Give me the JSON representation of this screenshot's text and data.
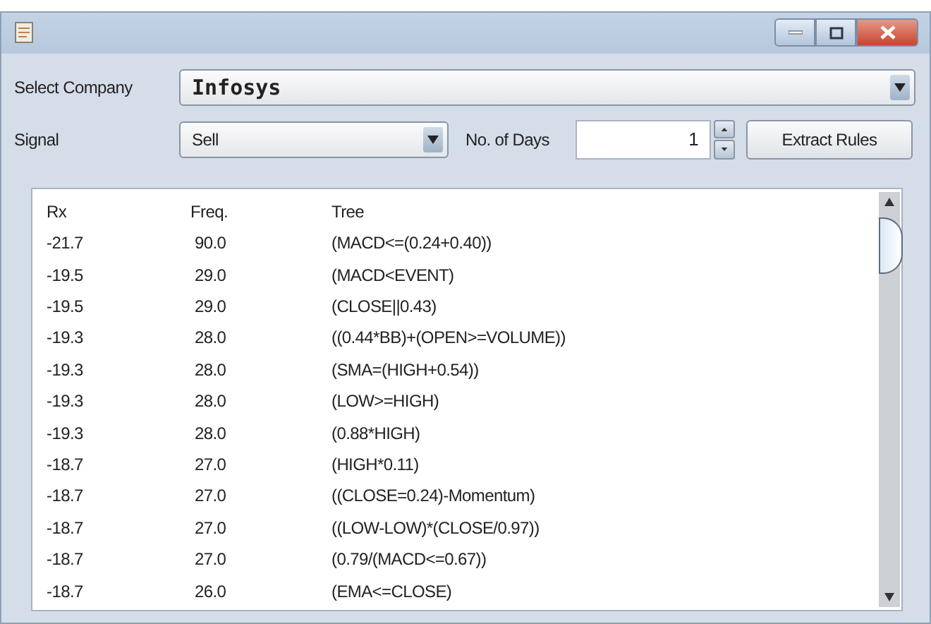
{
  "company": {
    "label": "Select Company",
    "value": "Infosys"
  },
  "signal": {
    "label": "Signal",
    "value": "Sell"
  },
  "days": {
    "label": "No. of Days",
    "value": "1"
  },
  "extract_button": "Extract Rules",
  "table": {
    "columns": [
      "Rx",
      "Freq.",
      "Tree"
    ],
    "rows": [
      [
        "-21.7",
        "90.0",
        "(MACD<=(0.24+0.40))"
      ],
      [
        "-19.5",
        "29.0",
        "(MACD<EVENT)"
      ],
      [
        "-19.5",
        "29.0",
        "(CLOSE||0.43)"
      ],
      [
        "-19.3",
        "28.0",
        "((0.44*BB)+(OPEN>=VOLUME))"
      ],
      [
        "-19.3",
        "28.0",
        "(SMA=(HIGH+0.54))"
      ],
      [
        "-19.3",
        "28.0",
        "(LOW>=HIGH)"
      ],
      [
        "-19.3",
        "28.0",
        "(0.88*HIGH)"
      ],
      [
        "-18.7",
        "27.0",
        "(HIGH*0.11)"
      ],
      [
        "-18.7",
        "27.0",
        "((CLOSE=0.24)-Momentum)"
      ],
      [
        "-18.7",
        "27.0",
        "((LOW-LOW)*(CLOSE/0.97))"
      ],
      [
        "-18.7",
        "27.0",
        "(0.79/(MACD<=0.67))"
      ],
      [
        "-18.7",
        "26.0",
        "(EMA<=CLOSE)"
      ]
    ]
  }
}
